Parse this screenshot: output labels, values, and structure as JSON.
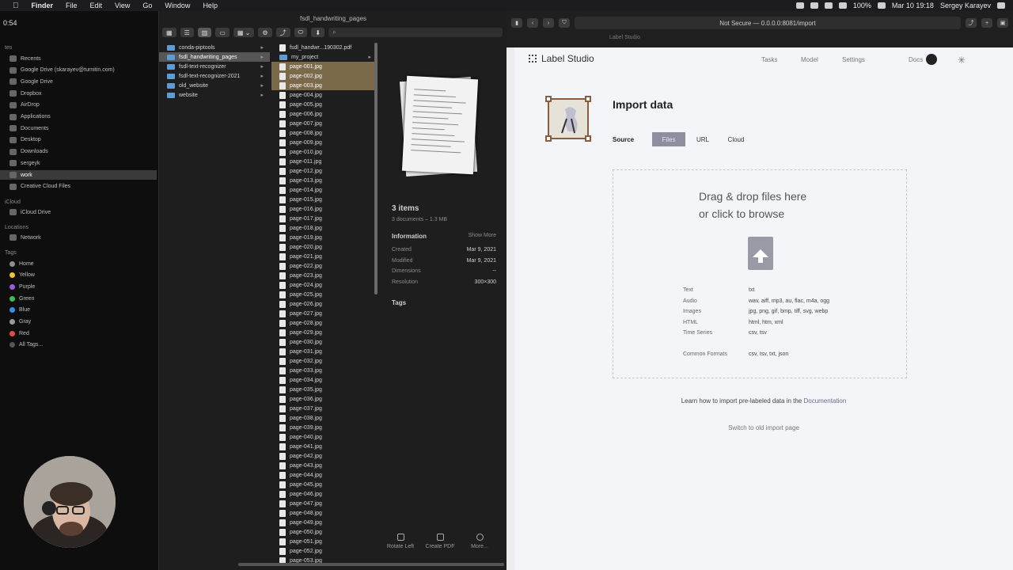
{
  "menubar": {
    "apple": "",
    "items": [
      "Finder",
      "File",
      "Edit",
      "View",
      "Go",
      "Window",
      "Help"
    ],
    "right": {
      "battery": "100%",
      "clock": "Mar 10  19:18",
      "user": "Sergey Karayev"
    }
  },
  "timer": "0:54",
  "sidebar": {
    "sections": {
      "favorites": "tes",
      "icloud": "iCloud",
      "locations": "Locations",
      "tags": "Tags"
    },
    "favorites": [
      "Recents",
      "Google Drive (skarayev@turnitin.com)",
      "Google Drive",
      "Dropbox",
      "AirDrop",
      "Applications",
      "Documents",
      "Desktop",
      "Downloads",
      "sergeyk",
      "work",
      "Creative Cloud Files"
    ],
    "selected": "work",
    "icloud": [
      "iCloud Drive"
    ],
    "locations": [
      "Network"
    ],
    "tags": [
      {
        "label": "Home",
        "color": "#8e8e93"
      },
      {
        "label": "Yellow",
        "color": "#f4c430"
      },
      {
        "label": "Purple",
        "color": "#a05ad8"
      },
      {
        "label": "Green",
        "color": "#44b84a"
      },
      {
        "label": "Blue",
        "color": "#3a8df0"
      },
      {
        "label": "Gray",
        "color": "#9a9a9a"
      },
      {
        "label": "Red",
        "color": "#ea4a3c"
      },
      {
        "label": "All Tags...",
        "color": "#555555"
      }
    ]
  },
  "finder": {
    "window_title": "fsdl_handwriting_pages",
    "toolbar": {
      "actions": "⚙",
      "share": "⤴",
      "tag": "⬭",
      "dropbox": "⬇"
    },
    "col1": [
      {
        "label": "conda-piptools",
        "selected": false
      },
      {
        "label": "fsdl_handwriting_pages",
        "selected": true
      },
      {
        "label": "fsdl-text-recognizer",
        "selected": false
      },
      {
        "label": "fsdl-text-recognizer-2021",
        "selected": false
      },
      {
        "label": "old_website",
        "selected": false
      },
      {
        "label": "website",
        "selected": false
      }
    ],
    "col2_top": [
      "fsdl_handwr...190302.pdf",
      "my_project"
    ],
    "col2_files": [
      "page-001.jpg",
      "page-002.jpg",
      "page-003.jpg",
      "page-004.jpg",
      "page-005.jpg",
      "page-006.jpg",
      "page-007.jpg",
      "page-008.jpg",
      "page-009.jpg",
      "page-010.jpg",
      "page-011.jpg",
      "page-012.jpg",
      "page-013.jpg",
      "page-014.jpg",
      "page-015.jpg",
      "page-016.jpg",
      "page-017.jpg",
      "page-018.jpg",
      "page-019.jpg",
      "page-020.jpg",
      "page-021.jpg",
      "page-022.jpg",
      "page-023.jpg",
      "page-024.jpg",
      "page-025.jpg",
      "page-026.jpg",
      "page-027.jpg",
      "page-028.jpg",
      "page-029.jpg",
      "page-030.jpg",
      "page-031.jpg",
      "page-032.jpg",
      "page-033.jpg",
      "page-034.jpg",
      "page-035.jpg",
      "page-036.jpg",
      "page-037.jpg",
      "page-038.jpg",
      "page-039.jpg",
      "page-040.jpg",
      "page-041.jpg",
      "page-042.jpg",
      "page-043.jpg",
      "page-044.jpg",
      "page-045.jpg",
      "page-046.jpg",
      "page-047.jpg",
      "page-048.jpg",
      "page-049.jpg",
      "page-050.jpg",
      "page-051.jpg",
      "page-052.jpg",
      "page-053.jpg"
    ],
    "highlighted_count": 3,
    "preview": {
      "items": "3 items",
      "sub": "3 documents – 1.3 MB",
      "info_label": "Information",
      "show_more": "Show More",
      "rows": [
        {
          "k": "Created",
          "v": "Mar 9, 2021"
        },
        {
          "k": "Modified",
          "v": "Mar 9, 2021"
        },
        {
          "k": "Dimensions",
          "v": "--"
        },
        {
          "k": "Resolution",
          "v": "300×300"
        }
      ],
      "tags_label": "Tags",
      "buttons": [
        "Rotate Left",
        "Create PDF",
        "More..."
      ]
    }
  },
  "browser": {
    "url": "Not Secure — 0.0.0.0:8081/import",
    "tab": "Label Studio"
  },
  "label_studio": {
    "brand": "Label Studio",
    "nav": [
      "Tasks",
      "Model",
      "Settings",
      "Docs"
    ],
    "title": "Import data",
    "source_label": "Source",
    "source_tabs": [
      "Files",
      "URL",
      "Cloud"
    ],
    "drop_line1": "Drag & drop files here",
    "drop_line2": "or click to browse",
    "formats": [
      {
        "k": "Text",
        "v": "txt"
      },
      {
        "k": "Audio",
        "v": "wav, aiff, mp3, au, flac, m4a, ogg"
      },
      {
        "k": "Images",
        "v": "jpg, png, gif, bmp, tiff, svg, webp"
      },
      {
        "k": "HTML",
        "v": "html, htm, xml"
      },
      {
        "k": "Time Series",
        "v": "csv, tsv"
      },
      {
        "k": "Common Formats",
        "v": "csv, tsv, txt, json"
      }
    ],
    "learn_prefix": "Learn how to import pre-labeled data in the ",
    "learn_link": "Documentation",
    "old_import": "Switch to old import page"
  }
}
